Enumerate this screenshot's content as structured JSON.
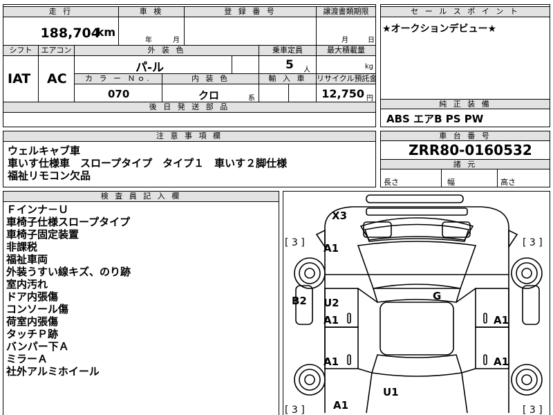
{
  "vehicle": {
    "mileage_header": "走 行",
    "mileage_value": "188,704",
    "mileage_unit": "km",
    "inspection_header": "車 検",
    "inspection_year_label": "年",
    "inspection_month_label": "月",
    "registration_header": "登 録 番 号",
    "transfer_header": "譲渡書類期限",
    "transfer_month_label": "月",
    "transfer_day_label": "日",
    "shift_header": "シフト",
    "shift_value": "IAT",
    "aircon_header": "エアコン",
    "aircon_value": "AC",
    "exterior_color_header": "外 装 色",
    "exterior_color_value": "パ-ル",
    "capacity_header": "乗車定員",
    "capacity_value": "5",
    "capacity_unit": "人",
    "max_load_header": "最大積載量",
    "max_load_unit": "kg",
    "color_no_header": "カ ラ ー Ｎｏ.",
    "color_no_value": "070",
    "interior_color_header": "内 装 色",
    "interior_color_value": "クロ",
    "interior_color_suffix": "系",
    "import_header": "輸 入 車",
    "recycle_header": "リサイクル預託金",
    "recycle_value": "12,750",
    "recycle_unit": "円",
    "later_parts_header": "後 日 発 送 部 品"
  },
  "sales_point": {
    "header": "セ ー ル ス ポ イ ン ト",
    "text": "★オークションデビュー★"
  },
  "equipment": {
    "header": "純 正 装 備",
    "items": "ABS エアB PS PW"
  },
  "notes": {
    "header": "注 意 事 項 欄",
    "lines": [
      "ウェルキャブ車",
      "車いす仕様車　スロープタイプ　タイプ１　車いす２脚仕様",
      "福祉リモコン欠品"
    ]
  },
  "chassis": {
    "header": "車 台 番 号",
    "value": "ZRR80-0160532",
    "dims_header": "諸 元",
    "length_label": "長さ",
    "width_label": "幅",
    "height_label": "高さ"
  },
  "inspector": {
    "header": "検 査 員 記 入 欄",
    "lines": [
      "Ｆインナ－Ｕ",
      "車椅子仕様スロープタイプ",
      "車椅子固定装置",
      "非課税",
      "福祉車両",
      "外装うすい線キズ、のり跡",
      "室内汚れ",
      "ドア内張傷",
      "コンソール傷",
      "荷室内張傷",
      "タッチＰ跡",
      "バンパー下Ａ",
      "ミラーＡ",
      "社外アルミホイール"
    ]
  },
  "diagram": {
    "marks": {
      "x3": "X3",
      "a1_front_left": "A1",
      "b2": "B2",
      "u2": "U2",
      "a1_left_front_door": "A1",
      "a1_left_rear_door": "A1",
      "a1_rear_left": "A1",
      "g": "G",
      "a1_right_front_door": "A1",
      "a1_right_rear_door": "A1",
      "u1": "U1"
    },
    "tire_marks": {
      "front_left": "[ 3 ]",
      "front_right": "[ 3 ]",
      "rear_left": "[ 3 ]",
      "rear_right": "[ 3 ]"
    }
  }
}
